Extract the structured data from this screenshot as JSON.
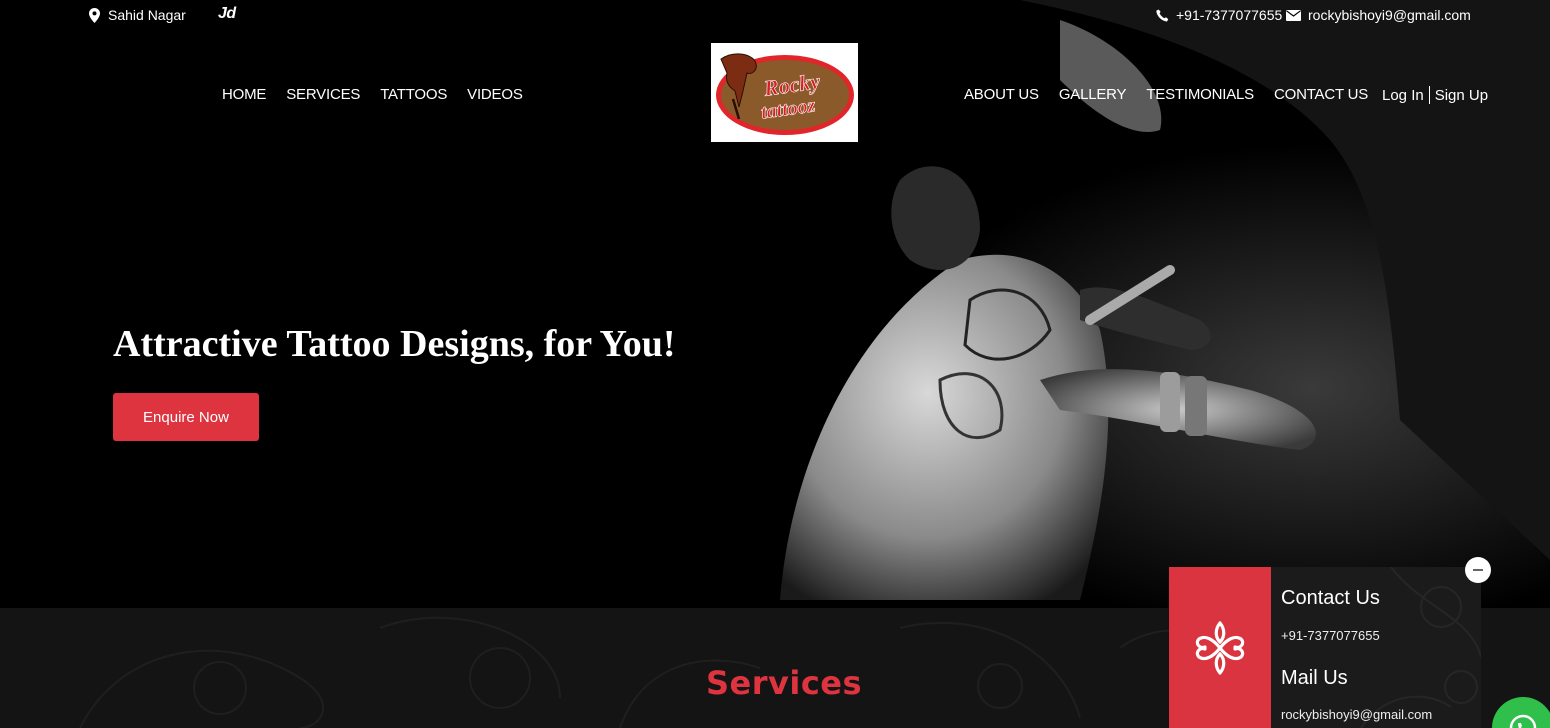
{
  "topbar": {
    "location": "Sahid Nagar",
    "jd_label": "Jd",
    "phone": "+91-7377077655",
    "email": "rockybishoyi9@gmail.com"
  },
  "nav": {
    "left": [
      "HOME",
      "SERVICES",
      "TATTOOS",
      "VIDEOS"
    ],
    "right": [
      "ABOUT US",
      "GALLERY",
      "TESTIMONIALS",
      "CONTACT US"
    ],
    "login": "Log In",
    "signup": "Sign Up"
  },
  "logo": {
    "line1": "Rocky",
    "line2": "tattooz"
  },
  "hero": {
    "headline": "Attractive Tattoo Designs, for You!",
    "cta": "Enquire Now"
  },
  "services": {
    "title": "Services"
  },
  "contact_panel": {
    "contact_title": "Contact Us",
    "contact_value": "+91-7377077655",
    "mail_title": "Mail Us",
    "mail_value": "rockybishoyi9@gmail.com"
  },
  "colors": {
    "accent": "#dd3440",
    "whatsapp": "#2fbf4a",
    "background": "#000000"
  },
  "icons": [
    "location-pin-icon",
    "phone-icon",
    "mail-icon",
    "tribal-ornament-icon",
    "minimize-icon",
    "whatsapp-icon"
  ]
}
